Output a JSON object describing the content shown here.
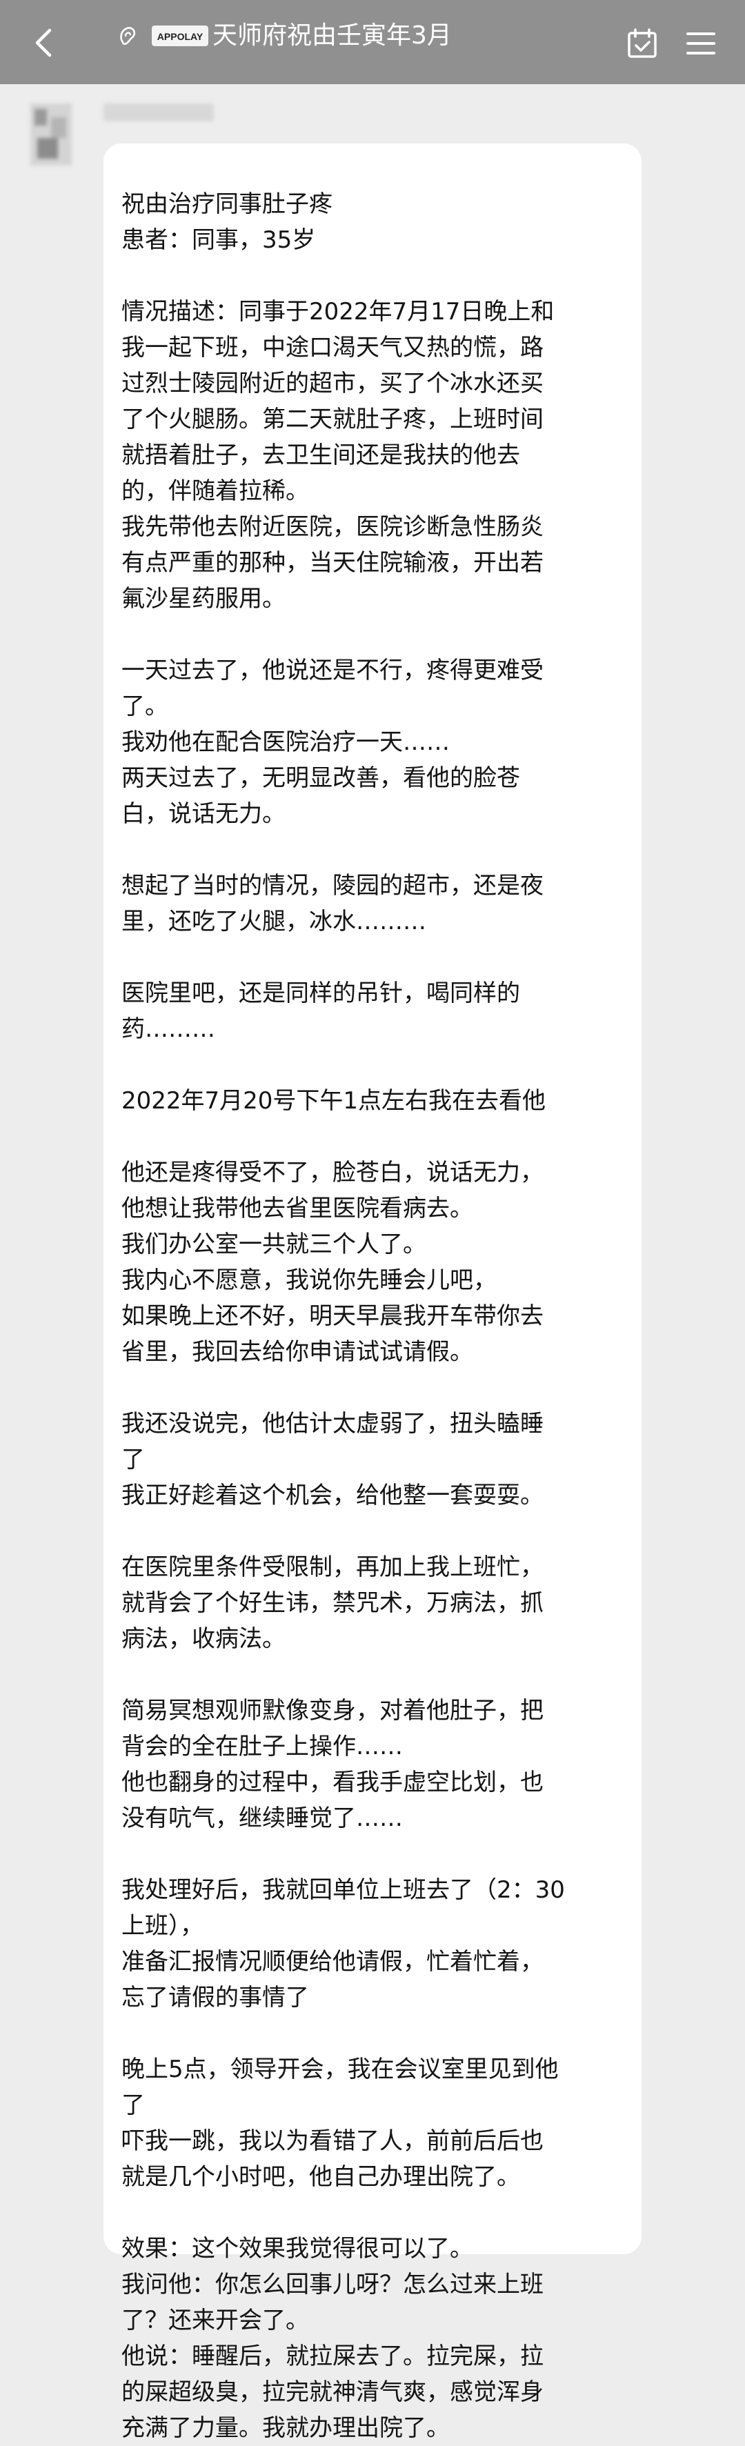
{
  "header": {
    "title": "天师府祝由壬寅年3月",
    "logo_text": "APPOLAY",
    "back_icon": "chevron-left-icon",
    "calendar_icon": "calendar-check-icon",
    "menu_icon": "menu-icon"
  },
  "message": {
    "blocks": [
      [
        "祝由治疗同事肚子疼",
        "患者：同事，35岁"
      ],
      [
        "情况描述：同事于2022年7月17日晚上和",
        "我一起下班，中途口渴天气又热的慌，路",
        "过烈士陵园附近的超市，买了个冰水还买",
        "了个火腿肠。第二天就肚子疼，上班时间",
        "就捂着肚子，去卫生间还是我扶的他去",
        "的，伴随着拉稀。",
        "我先带他去附近医院，医院诊断急性肠炎",
        "有点严重的那种，当天住院输液，开出若",
        "氟沙星药服用。"
      ],
      [
        "一天过去了，他说还是不行，疼得更难受",
        "了。",
        "我劝他在配合医院治疗一天……",
        "两天过去了，无明显改善，看他的脸苍",
        "白，说话无力。"
      ],
      [
        "想起了当时的情况，陵园的超市，还是夜",
        "里，还吃了火腿，冰水………"
      ],
      [
        "医院里吧，还是同样的吊针，喝同样的",
        "药………"
      ],
      [
        "2022年7月20号下午1点左右我在去看他"
      ],
      [
        "他还是疼得受不了，脸苍白，说话无力，",
        "他想让我带他去省里医院看病去。",
        "我们办公室一共就三个人了。",
        "我内心不愿意，我说你先睡会儿吧，",
        "如果晚上还不好，明天早晨我开车带你去",
        "省里，我回去给你申请试试请假。"
      ],
      [
        "我还没说完，他估计太虚弱了，扭头瞌睡",
        "了",
        "我正好趁着这个机会，给他整一套耍耍。"
      ],
      [
        "在医院里条件受限制，再加上我上班忙，",
        "就背会了个好生讳，禁咒术，万病法，抓",
        "病法，收病法。"
      ],
      [
        "简易冥想观师默像变身，对着他肚子，把",
        "背会的全在肚子上操作……",
        "他也翻身的过程中，看我手虚空比划，也",
        "没有吭气，继续睡觉了……"
      ],
      [
        "我处理好后，我就回单位上班去了（2：30",
        "上班），",
        "准备汇报情况顺便给他请假，忙着忙着，",
        "忘了请假的事情了"
      ],
      [
        "晚上5点，领导开会，我在会议室里见到他",
        "了",
        "吓我一跳，我以为看错了人，前前后后也",
        "就是几个小时吧，他自己办理出院了。"
      ],
      [
        "效果：这个效果我觉得很可以了。",
        "我问他：你怎么回事儿呀？怎么过来上班",
        "了？还来开会了。",
        "他说：睡醒后，就拉屎去了。拉完屎，拉",
        "的屎超级臭，拉完就神清气爽，感觉浑身",
        "充满了力量。我就办理出院了。"
      ]
    ]
  }
}
